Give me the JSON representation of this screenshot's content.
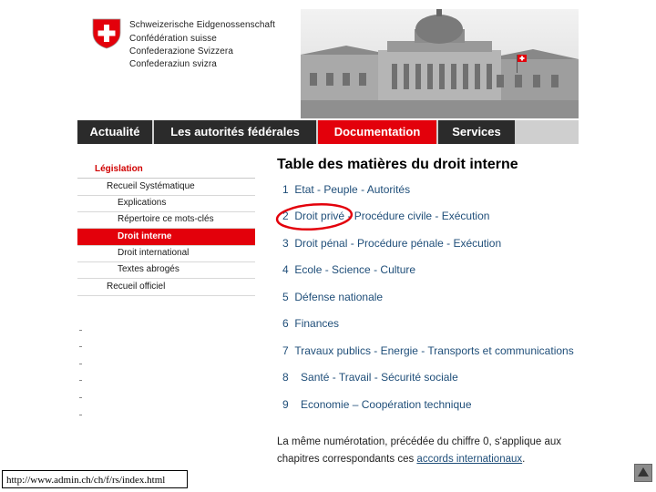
{
  "header": {
    "org_lines": [
      "Schweizerische Eidgenossenschaft",
      "Confédération suisse",
      "Confederazione Svizzera",
      "Confederaziun svizra"
    ]
  },
  "nav": {
    "items": [
      {
        "label": "Actualité"
      },
      {
        "label": "Les autorités fédérales"
      },
      {
        "label": "Documentation"
      },
      {
        "label": "Services"
      }
    ]
  },
  "sidebar": {
    "items": [
      {
        "label": "Législation"
      },
      {
        "label": "Recueil Systématique"
      },
      {
        "label": "Explications"
      },
      {
        "label": "Répertoire ce mots-clés"
      },
      {
        "label": "Droit interne"
      },
      {
        "label": "Droit international"
      },
      {
        "label": "Textes abrogés"
      },
      {
        "label": "Recueil officiel"
      }
    ]
  },
  "main": {
    "title": "Table des matières du droit interne",
    "toc": [
      {
        "num": "1",
        "text": "Etat - Peuple - Autorités"
      },
      {
        "num": "2",
        "text": "Droit privé - Procédure civile  - Exécution"
      },
      {
        "num": "3",
        "text": "Droit pénal - Procédure pénale  - Exécution"
      },
      {
        "num": "4",
        "text": "Ecole - Science - Culture"
      },
      {
        "num": "5",
        "text": "Défense nationale"
      },
      {
        "num": "6",
        "text": "Finances"
      },
      {
        "num": "7",
        "text": "Travaux publics - Energie - Transports et communications"
      },
      {
        "num": "8",
        "text": "Santé - Travail - Sécurité sociale"
      },
      {
        "num": "9",
        "text": "Economie – Coopération technique"
      }
    ],
    "note_line1": "La même numérotation, précédée du chiffre 0, s'applique aux",
    "note_line2_prefix": "chapitres correspondants ces",
    "note_link": "accords internationaux",
    "note_suffix": "."
  },
  "url": "http://www.admin.ch/ch/f/rs/index.html",
  "colors": {
    "accent_red": "#e3000b",
    "nav_dark": "#2b2b2b",
    "link_blue": "#1f4e79"
  },
  "icons": [
    "swiss-cross-icon",
    "scroll-top-icon"
  ]
}
